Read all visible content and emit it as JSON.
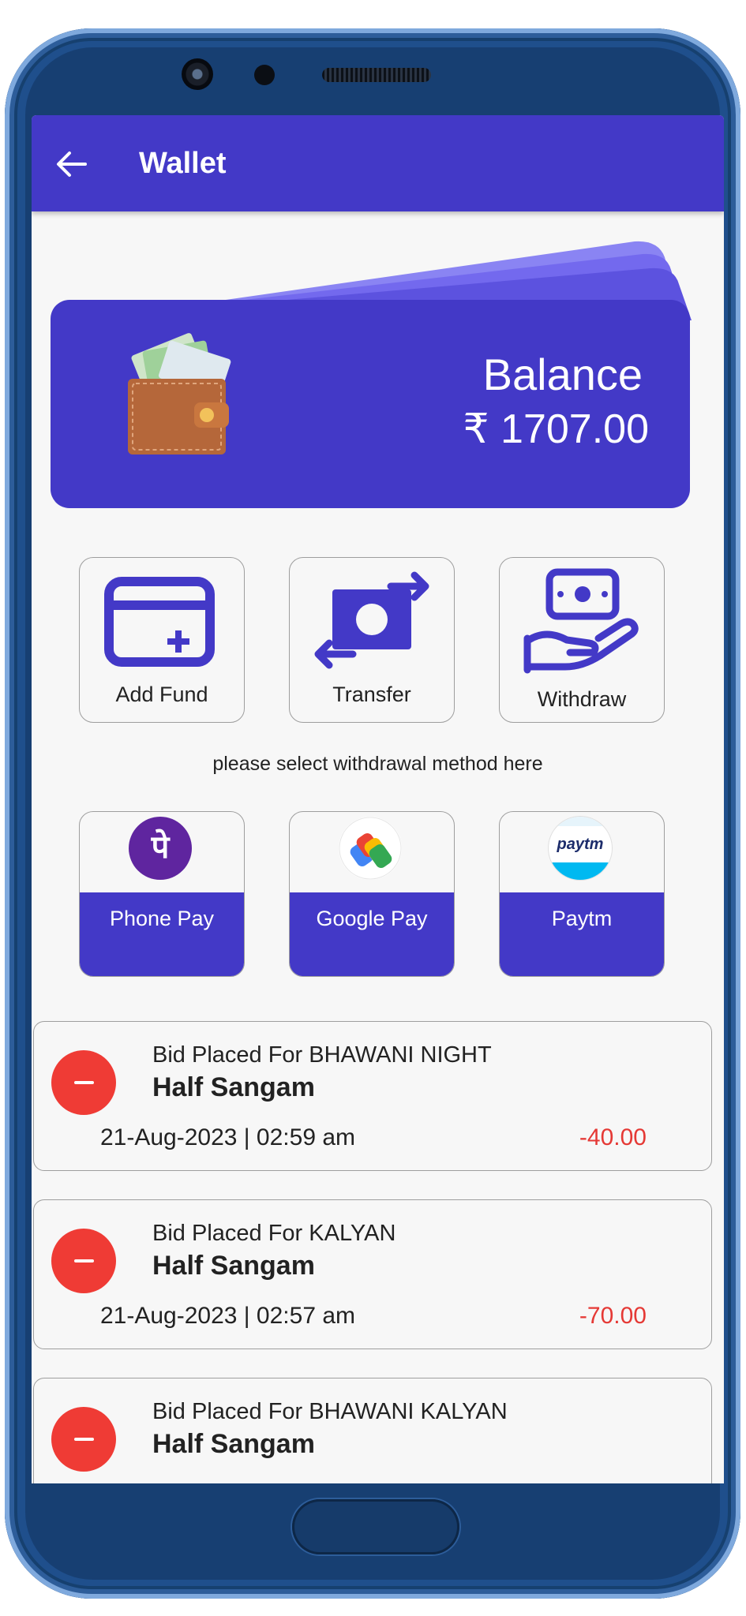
{
  "header": {
    "title": "Wallet"
  },
  "balance": {
    "label": "Balance",
    "value": "₹ 1707.00"
  },
  "actions": [
    {
      "label": "Add Fund",
      "icon": "wallet-plus-icon"
    },
    {
      "label": "Transfer",
      "icon": "money-transfer-icon"
    },
    {
      "label": "Withdraw",
      "icon": "hand-cash-icon"
    }
  ],
  "hint": "please select withdrawal method here",
  "payment_methods": [
    {
      "label": "Phone Pay",
      "logo_text": "पे"
    },
    {
      "label": "Google Pay"
    },
    {
      "label": "Paytm",
      "logo_text": "paytm"
    }
  ],
  "transactions": [
    {
      "title": "Bid Placed For BHAWANI NIGHT",
      "subtitle": "Half Sangam",
      "date": "21-Aug-2023 | 02:59 am",
      "amount": "-40.00"
    },
    {
      "title": "Bid Placed For KALYAN",
      "subtitle": "Half Sangam",
      "date": "21-Aug-2023 | 02:57 am",
      "amount": "-70.00"
    },
    {
      "title": "Bid Placed For BHAWANI KALYAN",
      "subtitle": "Half Sangam"
    }
  ],
  "colors": {
    "primary": "#4339c7",
    "debit": "#e53935",
    "minus_badge": "#ef3b35"
  }
}
